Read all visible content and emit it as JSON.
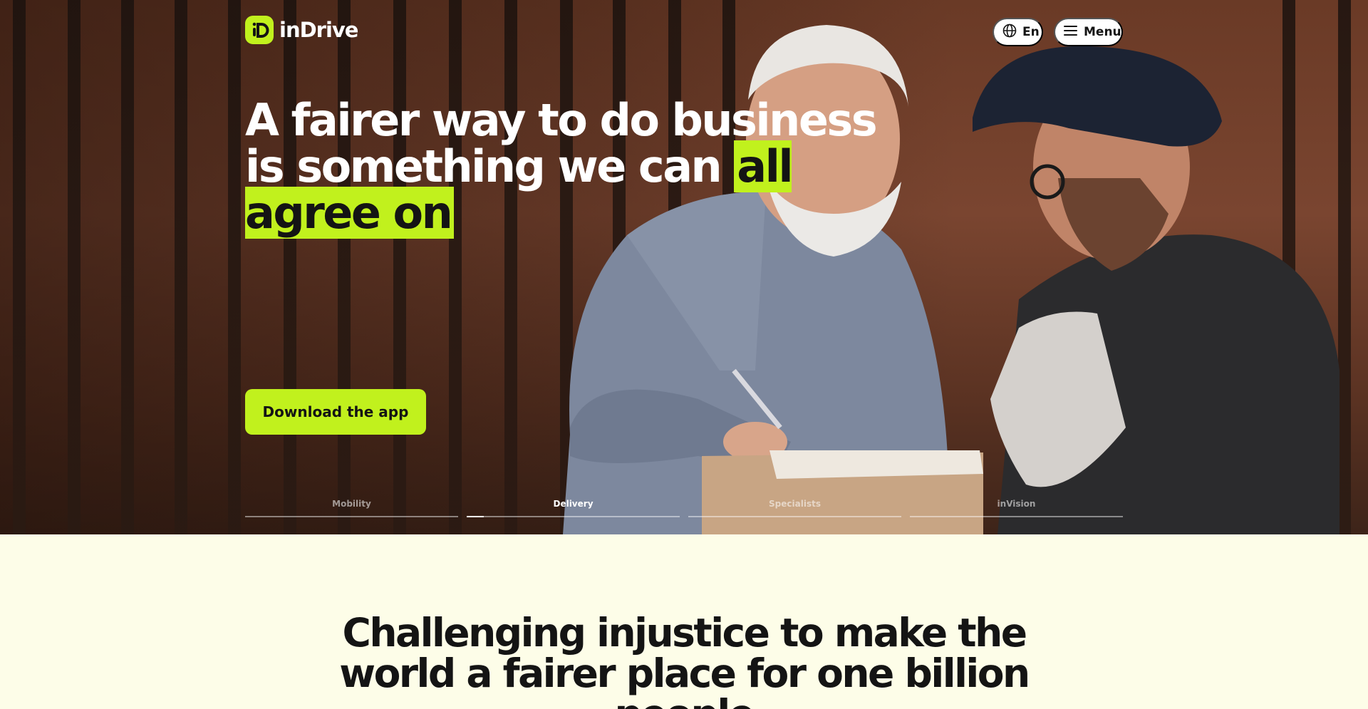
{
  "brand": {
    "name": "inDrive",
    "accent": "#c1f11d"
  },
  "header": {
    "language_label": "En",
    "menu_label": "Menu"
  },
  "hero": {
    "headline_part1": "A fairer way to do business is something we can ",
    "headline_highlight": "all agree on",
    "cta_label": "Download the app",
    "image_description": "Older man signing for a parcel handed over by a courier in a cap"
  },
  "tabs": [
    {
      "label": "Mobility",
      "active": false,
      "progress": 0
    },
    {
      "label": "Delivery",
      "active": true,
      "progress": 0.08
    },
    {
      "label": "Specialists",
      "active": false,
      "progress": 0
    },
    {
      "label": "inVision",
      "active": false,
      "progress": 0
    }
  ],
  "mission": {
    "title": "Challenging injustice to make the world a fairer place for one billion people"
  }
}
